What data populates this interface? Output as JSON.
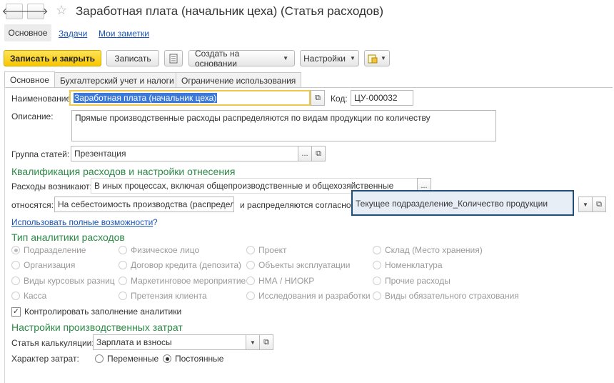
{
  "window": {
    "title": "Заработная плата (начальник цеха) (Статья расходов)"
  },
  "nav": {
    "back_icon": "arrow-left-icon",
    "forward_icon": "arrow-right-icon",
    "star_icon": "star-icon"
  },
  "form_tabs": [
    {
      "label": "Основное"
    },
    {
      "label": "Задачи"
    },
    {
      "label": "Мои заметки"
    }
  ],
  "toolbar": {
    "save_close_label": "Записать и закрыть",
    "save_label": "Записать",
    "create_based_label": "Создать на основании",
    "settings_label": "Настройки"
  },
  "tabs": [
    {
      "label": "Основное"
    },
    {
      "label": "Бухгалтерский учет и налоги"
    },
    {
      "label": "Ограничение использования"
    }
  ],
  "form": {
    "name_label": "Наименование:",
    "name_value": "Заработная плата (начальник цеха)",
    "code_label": "Код:",
    "code_value": "ЦУ-000032",
    "description_label": "Описание:",
    "description_value": "Прямые производственные расходы распределяются по видам продукции по количеству",
    "group_label": "Группа статей:",
    "group_value": "Презентация",
    "group_more": "...",
    "qualification_title": "Квалификация расходов и настройки отнесения",
    "arise_label": "Расходы возникают:",
    "arise_value": "В иных процессах, включая общепроизводственные и общехозяйственные",
    "arise_more": "...",
    "assign_label": "относятся:",
    "assign_value": "На себестоимость производства (распределя",
    "distribute_label": "и распределяются согласно:",
    "distribute_value": "Текущее подразделение_Количество продукции",
    "full_features_link": "Использовать полные возможности",
    "help_mark": "?",
    "analytics_title": "Тип аналитики расходов",
    "analytics_options": [
      {
        "label": "Подразделение",
        "selected": true
      },
      {
        "label": "Физическое лицо",
        "selected": false
      },
      {
        "label": "Проект",
        "selected": false
      },
      {
        "label": "Склад (Место хранения)",
        "selected": false
      },
      {
        "label": "Организация",
        "selected": false
      },
      {
        "label": "Договор кредита (депозита)",
        "selected": false
      },
      {
        "label": "Объекты эксплуатации",
        "selected": false
      },
      {
        "label": "Номенклатура",
        "selected": false
      },
      {
        "label": "Виды курсовых разниц",
        "selected": false
      },
      {
        "label": "Маркетинговое мероприятие",
        "selected": false
      },
      {
        "label": "НМА / НИОКР",
        "selected": false
      },
      {
        "label": "Прочие расходы",
        "selected": false
      },
      {
        "label": "Касса",
        "selected": false
      },
      {
        "label": "Претензия клиента",
        "selected": false
      },
      {
        "label": "Исследования и разработки",
        "selected": false
      },
      {
        "label": "Виды обязательного страхования",
        "selected": false
      }
    ],
    "control_check_label": "Контролировать заполнение аналитики",
    "control_check_checked": true,
    "production_title": "Настройки производственных затрат",
    "calc_label": "Статья калькуляции:",
    "calc_value": "Зарплата и взносы",
    "cost_nature_label": "Характер затрат:",
    "cost_options": [
      {
        "label": "Переменные",
        "selected": false
      },
      {
        "label": "Постоянные",
        "selected": true
      }
    ]
  }
}
